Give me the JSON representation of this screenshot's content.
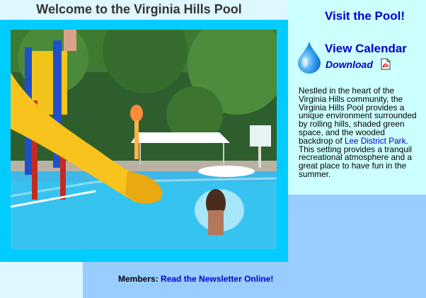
{
  "header": {
    "title": "Welcome to the Virginia Hills Pool"
  },
  "photo": {
    "alt": "Child splashing in pool next to yellow water slide",
    "icon": "pool-photo"
  },
  "sidebar": {
    "visit_label": "Visit the Pool!",
    "calendar_label": "View Calendar",
    "download_label": "Download",
    "drop_icon": "water-drop-icon",
    "pdf_icon": "pdf-icon",
    "description_before": "Nestled in the heart of the Virginia Hills community, the Virginia Hills Pool provides a unique environment surrounded by rolling hills, shaded green space, and the wooded backdrop of ",
    "park_link": "Lee District Park",
    "description_after": ". This setting provides a tranquil recreational atmosphere and a great place to have fun in the summer."
  },
  "footer": {
    "members_label": "Members:",
    "newsletter_link": "Read the Newsletter Online!"
  },
  "colors": {
    "frame": "#00ccff",
    "panel": "#ccffff",
    "background": "#99ccff",
    "title_band": "#dff7ff",
    "link": "#0000cc"
  }
}
